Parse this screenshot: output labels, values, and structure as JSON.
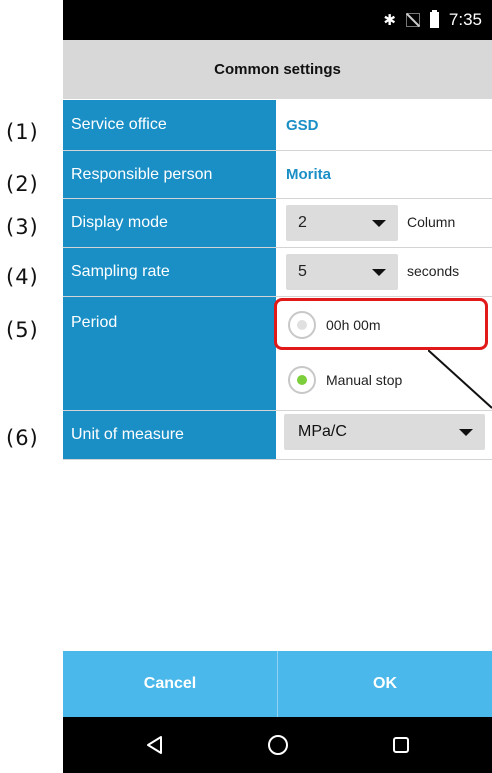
{
  "annotations": [
    "(1)",
    "(2)",
    "(3)",
    "(4)",
    "(5)",
    "(6)"
  ],
  "status_bar": {
    "time": "7:35",
    "icons": [
      "bluetooth-icon",
      "no-signal-icon",
      "battery-icon"
    ]
  },
  "title": "Common settings",
  "rows": {
    "service_office": {
      "label": "Service office",
      "value": "GSD"
    },
    "responsible_person": {
      "label": "Responsible person",
      "value": "Morita"
    },
    "display_mode": {
      "label": "Display mode",
      "selected": "2",
      "suffix": "Column"
    },
    "sampling_rate": {
      "label": "Sampling rate",
      "selected": "5",
      "suffix": "seconds"
    },
    "period": {
      "label": "Period",
      "options": [
        {
          "label": "00h 00m",
          "checked": false
        },
        {
          "label": "Manual stop",
          "checked": true
        }
      ]
    },
    "unit_of_measure": {
      "label": "Unit of measure",
      "selected": "MPa/C"
    }
  },
  "buttons": {
    "cancel": "Cancel",
    "ok": "OK"
  },
  "nav": {
    "icons": [
      "back-icon",
      "home-icon",
      "recents-icon"
    ]
  },
  "colors": {
    "label_bg": "#1a8fc6",
    "button_bg": "#4ab8ea",
    "highlight": "#e21919",
    "radio_checked": "#7ccf3a"
  }
}
